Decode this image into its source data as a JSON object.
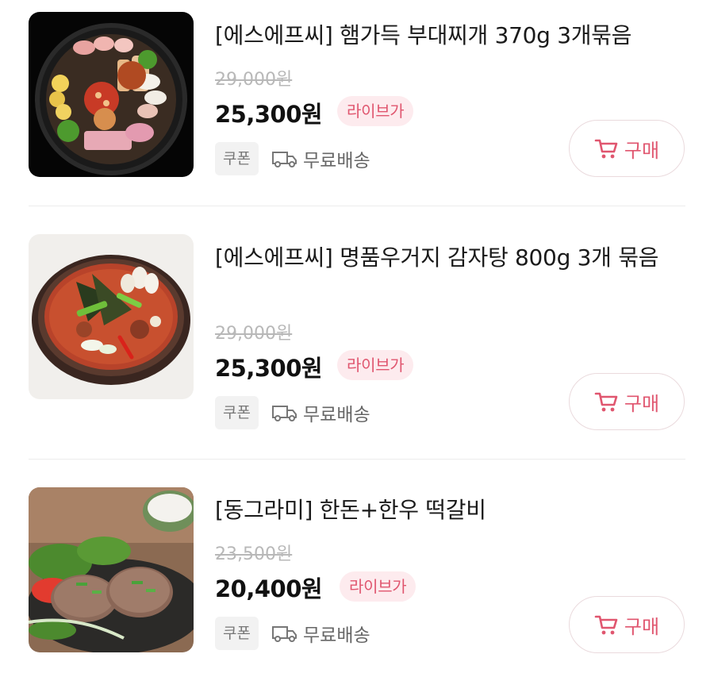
{
  "products": [
    {
      "title": "[에스에프씨] 햄가득 부대찌개 370g 3개묶음",
      "original_price": "29,000원",
      "price": "25,300원",
      "badge": "라이브가",
      "coupon": "쿠폰",
      "delivery": "무료배송",
      "buy_label": "구매",
      "image_icon": "budae-jjigae-photo"
    },
    {
      "title": "[에스에프씨] 명품우거지 감자탕 800g 3개 묶음",
      "original_price": "29,000원",
      "price": "25,300원",
      "badge": "라이브가",
      "coupon": "쿠폰",
      "delivery": "무료배송",
      "buy_label": "구매",
      "image_icon": "gamjatang-photo"
    },
    {
      "title": "[동그라미] 한돈+한우 떡갈비",
      "original_price": "23,500원",
      "price": "20,400원",
      "badge": "라이브가",
      "coupon": "쿠폰",
      "delivery": "무료배송",
      "buy_label": "구매",
      "image_icon": "tteokgalbi-photo"
    }
  ],
  "colors": {
    "accent": "#e0566f",
    "badge_bg": "#fdebee",
    "strike": "#b8b8b8",
    "coupon_bg": "#f2f2f2"
  }
}
